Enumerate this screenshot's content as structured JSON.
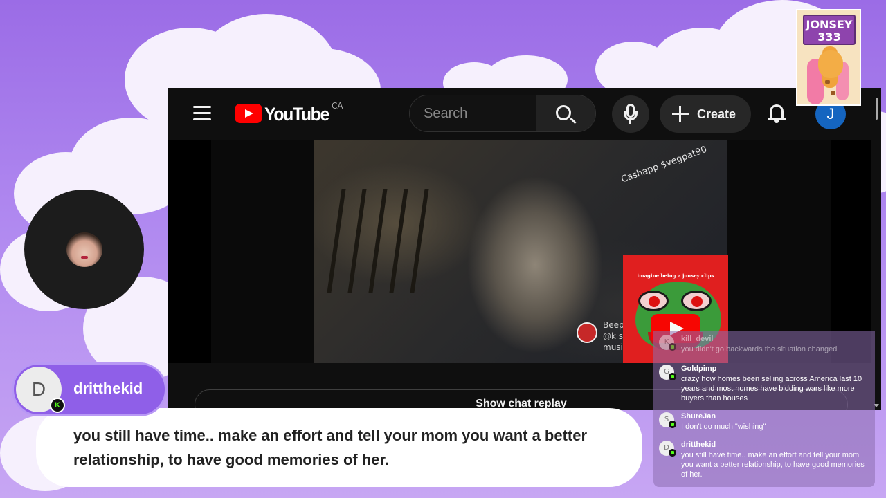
{
  "youtube": {
    "logo_text": "YouTube",
    "country": "CA",
    "search_placeholder": "Search",
    "create_label": "Create",
    "account_initial": "J",
    "video_watermark": "Cashapp $vegpat90",
    "beep_lines": [
      "Beep",
      "@k s",
      "musi"
    ],
    "pepe_caption": "imagine being a jonsey clips",
    "chat_replay_label": "Show chat replay"
  },
  "sticker": {
    "sign_line1": "JONSEY",
    "sign_line2": "333"
  },
  "kick_chat": {
    "messages": [
      {
        "user": "kill_devil",
        "initial": "K",
        "text": "you didn't go backwards the situation changed"
      },
      {
        "user": "Goldpimp",
        "initial": "G",
        "text": "crazy how homes been selling across America last 10 years and most homes have bidding wars like more buyers than houses"
      },
      {
        "user": "ShureJan",
        "initial": "S",
        "text": "I don't do much \"wishing\""
      },
      {
        "user": "dritthekid",
        "initial": "D",
        "text": "you still have time.. make an effort and tell your mom you want a better relationship, to have good memories of her."
      }
    ]
  },
  "highlight": {
    "initial": "D",
    "username": "dritthekid",
    "message": "you still have time.. make an effort and tell your mom you want a better relationship, to have good memories of her."
  },
  "colors": {
    "background": "#b089f0",
    "youtube_red": "#ff0000",
    "kick_green": "#53fc18",
    "highlight_pill": "#8f5fe8"
  }
}
